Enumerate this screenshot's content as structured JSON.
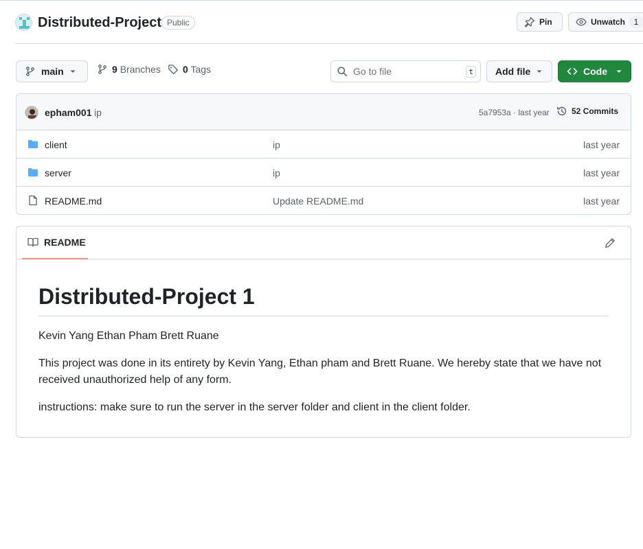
{
  "repo": {
    "name": "Distributed-Project",
    "visibility": "Public",
    "pin_label": "Pin",
    "unwatch_label": "Unwatch",
    "watch_count": "1"
  },
  "toolbar": {
    "branch": "main",
    "branches_count": "9",
    "branches_label": "Branches",
    "tags_count": "0",
    "tags_label": "Tags",
    "go_to_file_placeholder": "Go to file",
    "go_to_file_shortcut": "t",
    "add_file_label": "Add file",
    "code_label": "Code",
    "code_color": "#1f883d"
  },
  "latest_commit": {
    "author": "epham001",
    "message": "ip",
    "meta": "5a7953a · last year",
    "commits_label": "52 Commits"
  },
  "files": [
    {
      "name": "client",
      "type": "folder",
      "icon": "folder-icon",
      "commit": "ip",
      "time": "last year"
    },
    {
      "name": "server",
      "type": "folder",
      "icon": "folder-icon",
      "commit": "ip",
      "time": "last year"
    },
    {
      "name": "README.md",
      "type": "file",
      "icon": "file-icon",
      "commit": "Update README.md",
      "time": "last year"
    }
  ],
  "readme": {
    "tab_label": "README",
    "heading": "Distributed-Project 1",
    "paragraphs": [
      "Kevin Yang Ethan Pham Brett Ruane",
      "This project was done in its entirety by Kevin Yang, Ethan pham and Brett Ruane. We hereby state that we have not received unauthorized help of any form.",
      "instructions: make sure to run the server in the server folder and client in the client folder."
    ]
  },
  "colors": {
    "folder": "#54aeff",
    "tab_underline": "#fd8c73",
    "border": "#d0d7de"
  }
}
